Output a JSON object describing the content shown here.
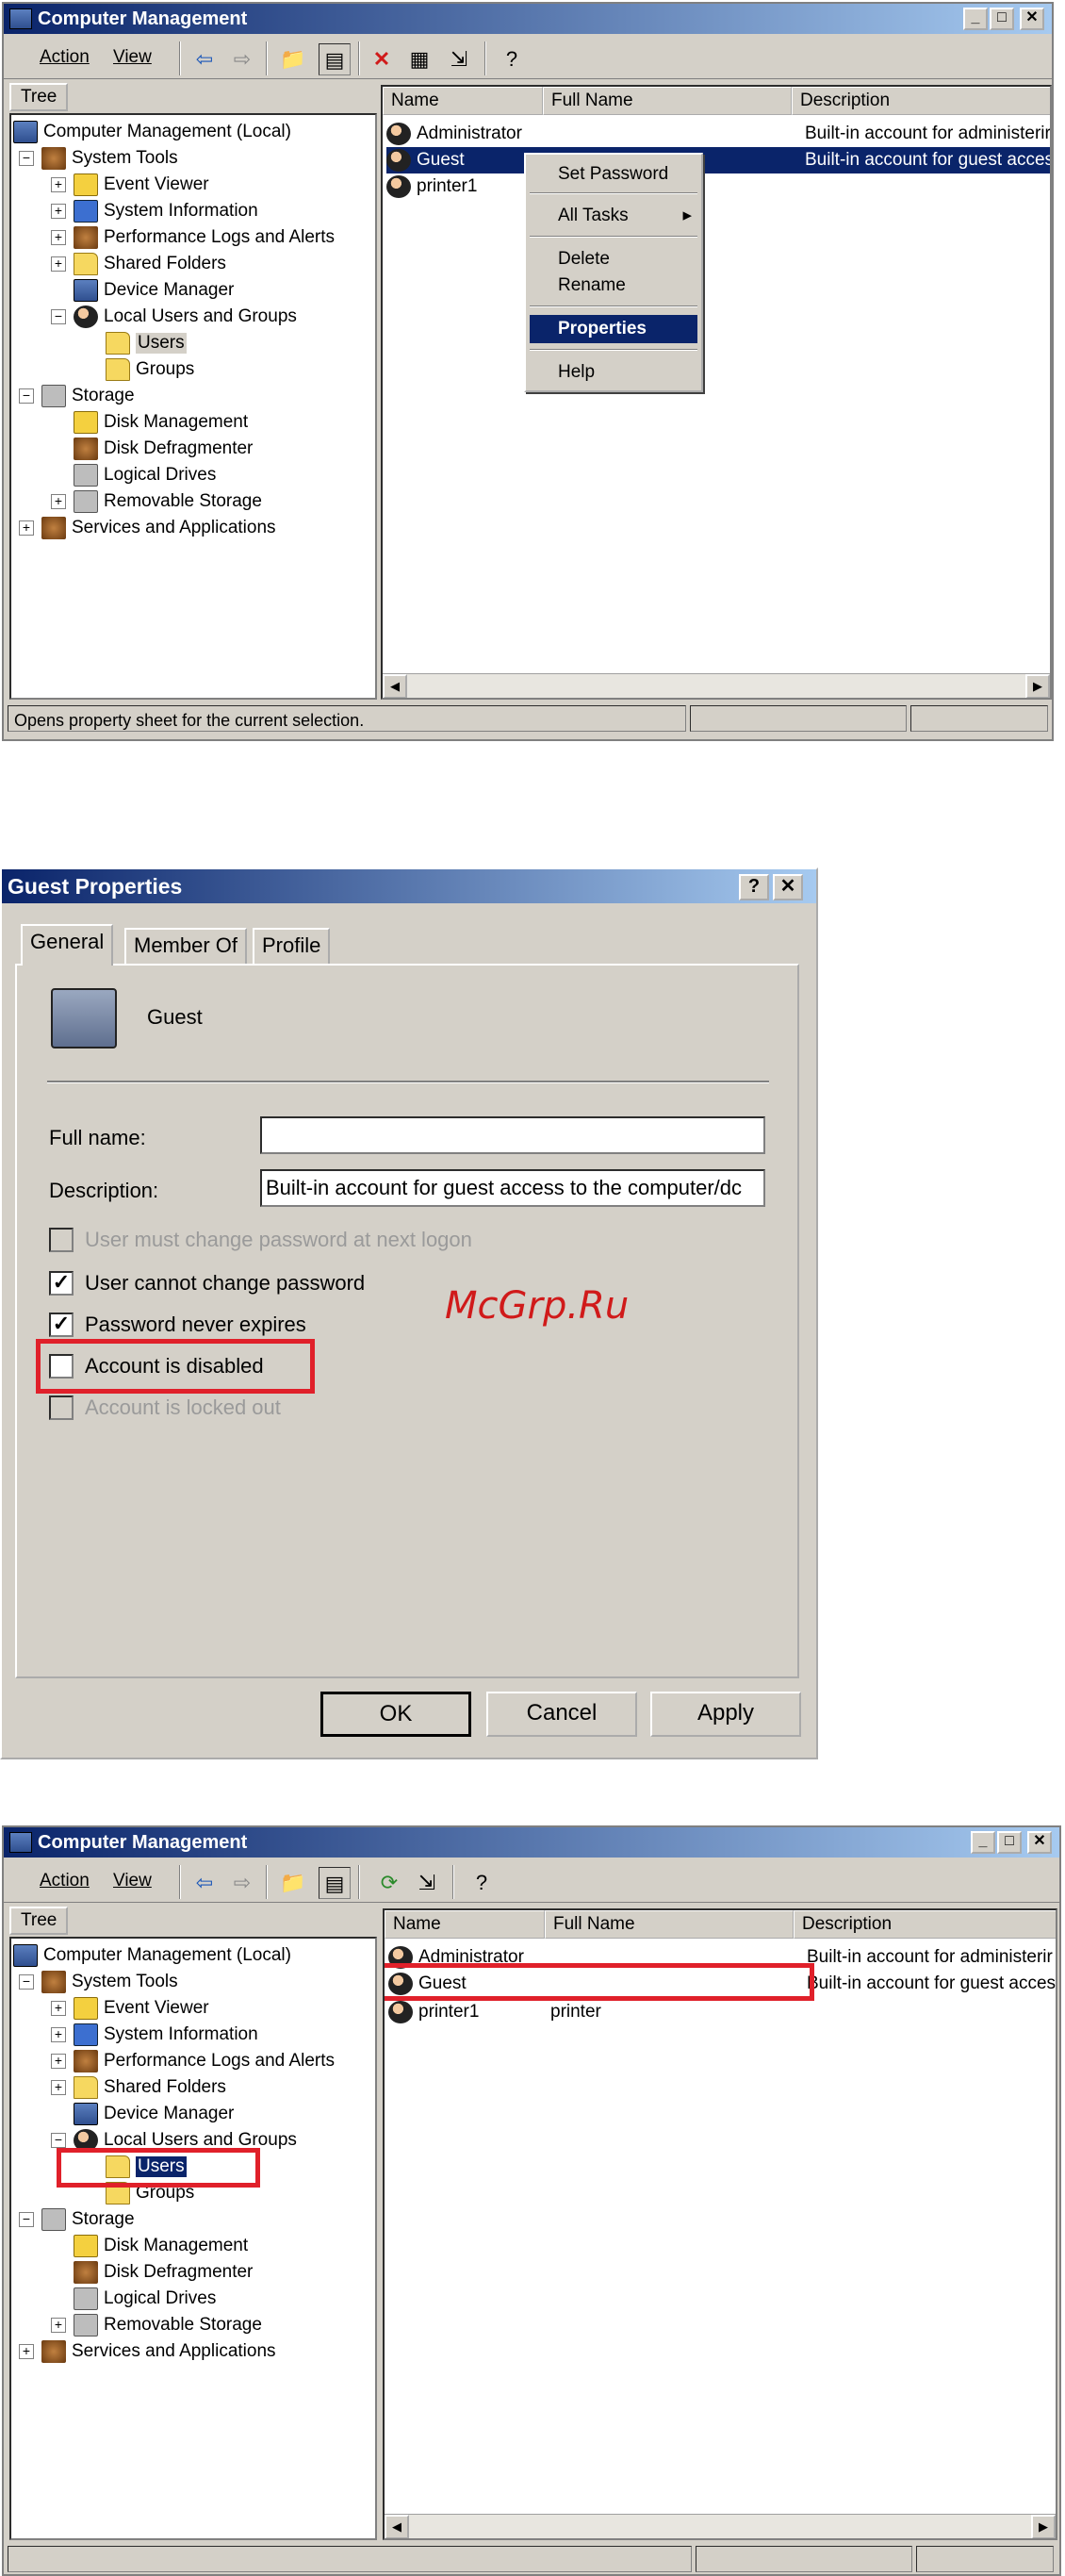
{
  "window1": {
    "title": "Computer Management",
    "menu": {
      "action": "Action",
      "view": "View"
    },
    "tree_tab": "Tree",
    "tree": [
      {
        "label": "Computer Management (Local)",
        "icon": "computer-icon"
      },
      {
        "label": "System Tools",
        "icon": "tools-icon"
      },
      {
        "label": "Event Viewer",
        "icon": "event-viewer-icon"
      },
      {
        "label": "System Information",
        "icon": "system-info-icon"
      },
      {
        "label": "Performance Logs and Alerts",
        "icon": "performance-icon"
      },
      {
        "label": "Shared Folders",
        "icon": "folder-icon"
      },
      {
        "label": "Device Manager",
        "icon": "device-manager-icon"
      },
      {
        "label": "Local Users and Groups",
        "icon": "users-groups-icon"
      },
      {
        "label": "Users",
        "icon": "folder-open-icon"
      },
      {
        "label": "Groups",
        "icon": "folder-icon"
      },
      {
        "label": "Storage",
        "icon": "storage-icon"
      },
      {
        "label": "Disk Management",
        "icon": "disk-icon"
      },
      {
        "label": "Disk Defragmenter",
        "icon": "defrag-icon"
      },
      {
        "label": "Logical Drives",
        "icon": "drive-icon"
      },
      {
        "label": "Removable Storage",
        "icon": "removable-icon"
      },
      {
        "label": "Services and Applications",
        "icon": "services-icon"
      }
    ],
    "columns": {
      "name": "Name",
      "full_name": "Full Name",
      "description": "Description"
    },
    "rows": [
      {
        "name": "Administrator",
        "full_name": "",
        "description": "Built-in account for administerir"
      },
      {
        "name": "Guest",
        "full_name": "",
        "description": "Built-in account for guest acces"
      },
      {
        "name": "printer1",
        "full_name": "",
        "description": ""
      }
    ],
    "context_menu": [
      "Set Password",
      "All Tasks",
      "Delete",
      "Rename",
      "Properties",
      "Help"
    ],
    "status": "Opens property sheet for the current selection."
  },
  "dialog": {
    "title": "Guest Properties",
    "help_btn": "?",
    "close_btn": "✕",
    "tabs": [
      "General",
      "Member Of",
      "Profile"
    ],
    "user_name": "Guest",
    "full_name_label": "Full name:",
    "full_name_value": "",
    "description_label": "Description:",
    "description_value": "Built-in account for guest access to the computer/dc",
    "checks": [
      {
        "label": "User must change password at next logon",
        "checked": false,
        "enabled": false
      },
      {
        "label": "User cannot change password",
        "checked": true,
        "enabled": true
      },
      {
        "label": "Password never expires",
        "checked": true,
        "enabled": true
      },
      {
        "label": "Account is disabled",
        "checked": false,
        "enabled": true
      },
      {
        "label": "Account is locked out",
        "checked": false,
        "enabled": false
      }
    ],
    "buttons": {
      "ok": "OK",
      "cancel": "Cancel",
      "apply": "Apply"
    }
  },
  "watermark": "McGrp.Ru",
  "window2": {
    "title": "Computer Management",
    "menu": {
      "action": "Action",
      "view": "View"
    },
    "tree_tab": "Tree",
    "columns": {
      "name": "Name",
      "full_name": "Full Name",
      "description": "Description"
    },
    "rows": [
      {
        "name": "Administrator",
        "full_name": "",
        "description": "Built-in account for administerir"
      },
      {
        "name": "Guest",
        "full_name": "",
        "description": "Built-in account for guest acces"
      },
      {
        "name": "printer1",
        "full_name": "printer",
        "description": ""
      }
    ]
  },
  "colors": {
    "titlebar": "#0a246a",
    "face": "#d4d0c8",
    "highlight": "#e0202a"
  }
}
